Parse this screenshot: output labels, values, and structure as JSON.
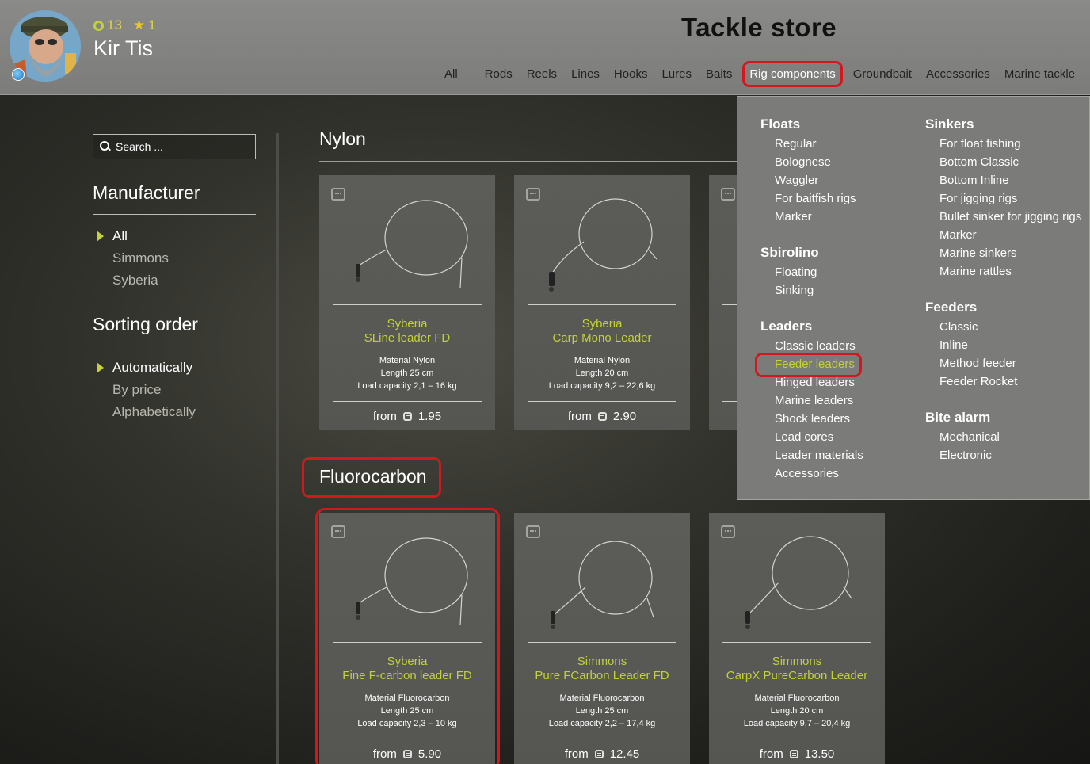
{
  "player": {
    "level": "13",
    "stars": "1",
    "name": "Kir Tis"
  },
  "header": {
    "title": "Tackle store"
  },
  "tabs": [
    "All",
    "Rods",
    "Reels",
    "Lines",
    "Hooks",
    "Lures",
    "Baits",
    "Rig components",
    "Groundbait",
    "Accessories",
    "Marine tackle"
  ],
  "active_tab": "Rig components",
  "search": {
    "placeholder": "Search ..."
  },
  "filters": {
    "manufacturer": {
      "title": "Manufacturer",
      "options": [
        "All",
        "Simmons",
        "Syberia"
      ],
      "selected": "All"
    },
    "sorting": {
      "title": "Sorting order",
      "options": [
        "Automatically",
        "By price",
        "Alphabetically"
      ],
      "selected": "Automatically"
    }
  },
  "sections": [
    {
      "title": "Nylon",
      "cards": [
        {
          "brand": "Syberia",
          "name": "SLine leader FD",
          "material": "Material Nylon",
          "length": "Length 25 cm",
          "load": "Load capacity 2,1 – 16 kg",
          "from": "from",
          "price": "1.95"
        },
        {
          "brand": "Syberia",
          "name": "Carp Mono Leader",
          "material": "Material Nylon",
          "length": "Length 20 cm",
          "load": "Load capacity 9,2 – 22,6 kg",
          "from": "from",
          "price": "2.90"
        }
      ]
    },
    {
      "title": "Fluorocarbon",
      "cards": [
        {
          "brand": "Syberia",
          "name": "Fine F-carbon leader FD",
          "material": "Material Fluorocarbon",
          "length": "Length 25 cm",
          "load": "Load capacity 2,3 – 10 kg",
          "from": "from",
          "price": "5.90"
        },
        {
          "brand": "Simmons",
          "name": "Pure FCarbon Leader FD",
          "material": "Material Fluorocarbon",
          "length": "Length 25 cm",
          "load": "Load capacity 2,2 – 17,4 kg",
          "from": "from",
          "price": "12.45"
        },
        {
          "brand": "Simmons",
          "name": "CarpX PureCarbon Leader",
          "material": "Material Fluorocarbon",
          "length": "Length 20 cm",
          "load": "Load capacity 9,7 – 20,4 kg",
          "from": "from",
          "price": "13.50"
        }
      ]
    }
  ],
  "dropdown": {
    "left_column": [
      {
        "title": "Floats",
        "items": [
          "Regular",
          "Bolognese",
          "Waggler",
          "For baitfish rigs",
          "Marker"
        ]
      },
      {
        "title": "Sbirolino",
        "items": [
          "Floating",
          "Sinking"
        ]
      },
      {
        "title": "Leaders",
        "items": [
          "Classic leaders",
          "Feeder leaders",
          "Hinged leaders",
          "Marine leaders",
          "Shock leaders",
          "Lead cores",
          "Leader materials",
          "Accessories"
        ]
      }
    ],
    "right_column": [
      {
        "title": "Sinkers",
        "items": [
          "For float fishing",
          "Bottom Classic",
          "Bottom Inline",
          "For jigging rigs",
          "Bullet sinker for jigging rigs",
          "Marker",
          "Marine sinkers",
          "Marine rattles"
        ]
      },
      {
        "title": "Feeders",
        "items": [
          "Classic",
          "Inline",
          "Method feeder",
          "Feeder Rocket"
        ]
      },
      {
        "title": "Bite alarm",
        "items": [
          "Mechanical",
          "Electronic"
        ]
      }
    ],
    "highlighted": "Feeder leaders"
  },
  "colors": {
    "accent": "#c4d138",
    "highlight_outline": "#d4161e",
    "header_bg": "#8a8a88",
    "dropdown_bg": "#7b7b79"
  }
}
